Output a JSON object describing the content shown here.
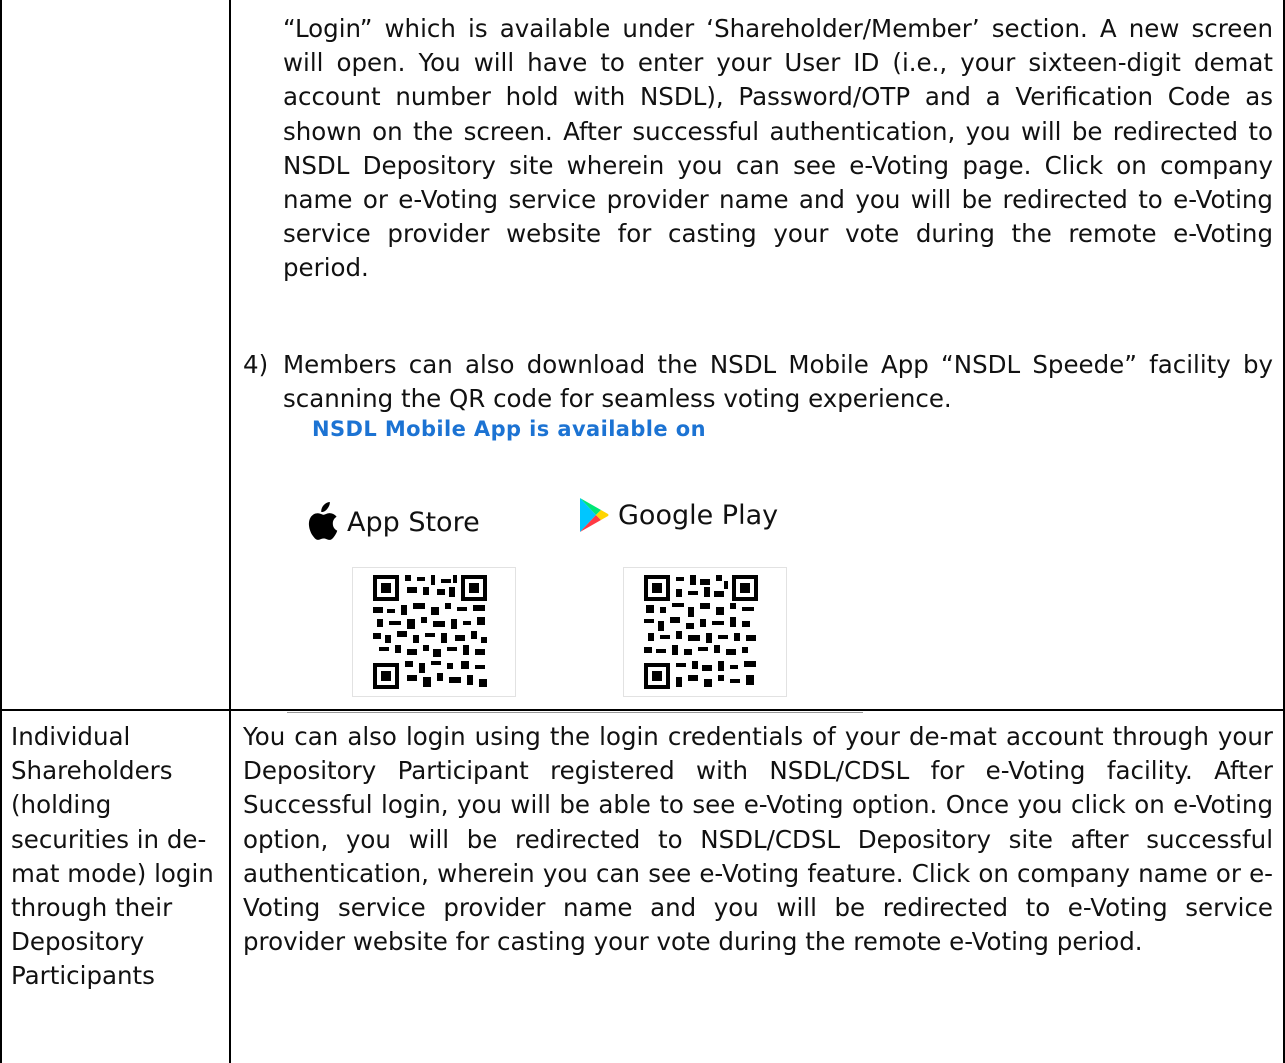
{
  "continued_cell": {
    "paragraph": "“Login” which is available under ‘Shareholder/Member’ section. A new screen will open. You will have to enter your User ID (i.e., your sixteen-digit demat account number hold with NSDL), Password/OTP and a Verification Code as shown on the screen. After successful authentication, you will be redirected to NSDL Depository site wherein you can see e-Voting page. Click on company name or e-Voting service provider name and you will be redirected to e-Voting service provider website for casting your vote during the remote e-Voting period.",
    "item_number": "4)",
    "item_text": "Members can also download the NSDL Mobile App “NSDL Speede” facility by scanning the QR code for seamless voting experience.",
    "app_heading": "NSDL Mobile App is available on",
    "app_store_label": "App Store",
    "google_play_label": "Google Play",
    "app_store_icon": "apple-icon",
    "google_play_icon": "google-play-icon",
    "heading_color": "#1c73d3"
  },
  "row_depository": {
    "left_label": "Individual Shareholders (holding securities in de-mat mode) login through their Depository Participants",
    "paragraph": "You can also login using the login credentials of your de-mat account through your Depository Participant registered with NSDL/CDSL for e-Voting facility. After Successful login, you will be able to see e-Voting option. Once you click on e-Voting option, you will be redirected to NSDL/CDSL Depository site after successful authentication, wherein you can see e-Voting feature. Click on company name or e-Voting service provider name and you will be redirected to e-Voting service provider website for casting your vote during the remote e-Voting period."
  }
}
